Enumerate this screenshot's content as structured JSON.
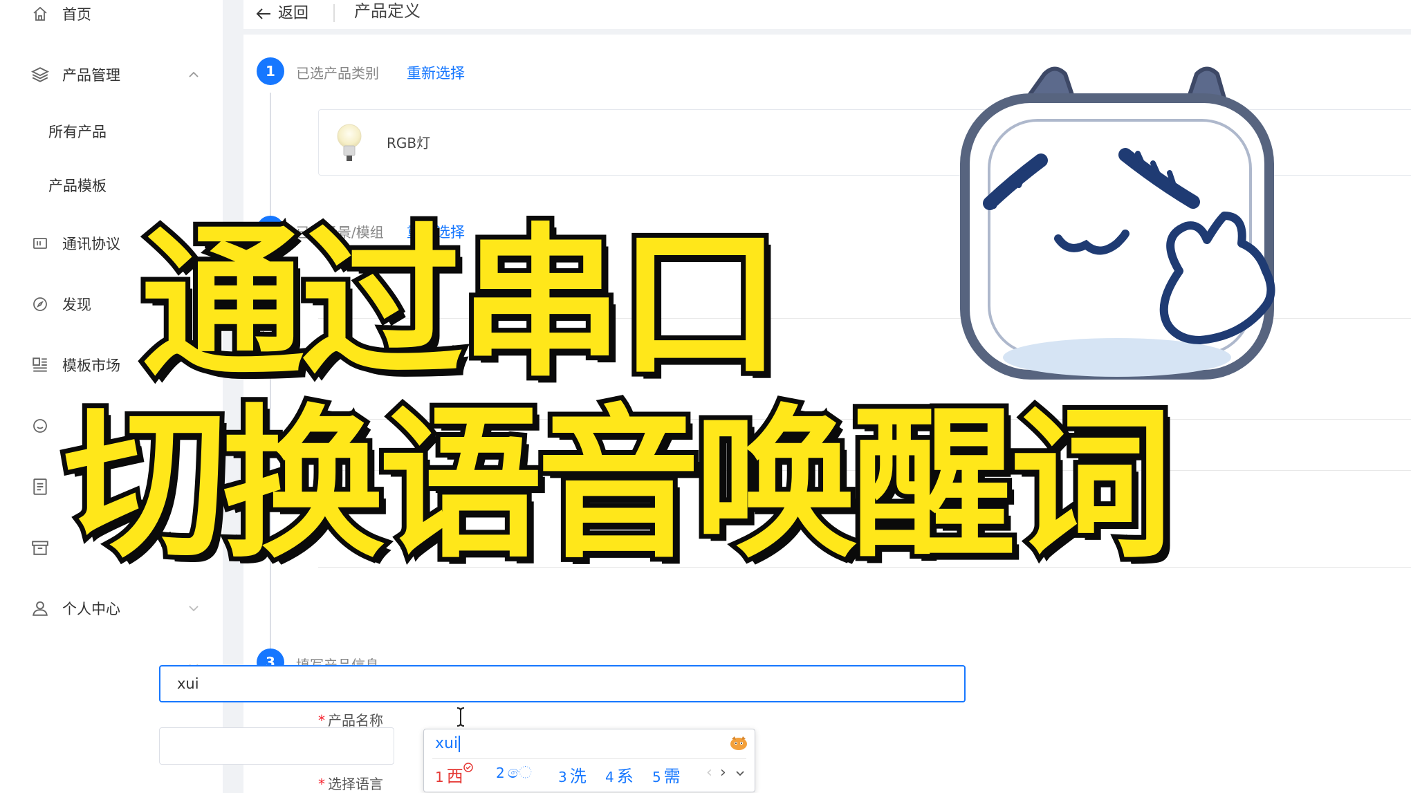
{
  "sidebar": {
    "items": [
      {
        "label": "首页",
        "icon": "home-icon"
      },
      {
        "label": "产品管理",
        "icon": "layers-icon",
        "expanded": true
      },
      {
        "label": "所有产品"
      },
      {
        "label": "产品模板"
      },
      {
        "label": "通讯协议",
        "icon": "protocol-icon"
      },
      {
        "label": "发现",
        "icon": "compass-icon"
      },
      {
        "label": "模板市场",
        "icon": "market-icon"
      },
      {
        "label": "个人中心",
        "icon": "user-icon"
      }
    ]
  },
  "header": {
    "back_label": "返回",
    "title": "产品定义"
  },
  "steps": [
    {
      "num": "1",
      "label": "已选产品类别",
      "action": "重新选择"
    },
    {
      "num": "2",
      "label": "已选场景/模组",
      "action": "重新选择"
    },
    {
      "num": "3",
      "label": "填写产品信息"
    }
  ],
  "product": {
    "name": "RGB灯",
    "icon": "bulb-icon"
  },
  "form": {
    "name_label": "产品名称",
    "name_value": "xui",
    "lang_label": "选择语言"
  },
  "ime": {
    "composition": "xui",
    "candidates": [
      {
        "num": "1",
        "text": "西"
      },
      {
        "num": "2",
        "text": "ෙ"
      },
      {
        "num": "3",
        "text": "洗"
      },
      {
        "num": "4",
        "text": "系"
      },
      {
        "num": "5",
        "text": "需"
      }
    ]
  },
  "overlay": {
    "line1": "通过串口",
    "line2": "切换语音唤醒词"
  },
  "colors": {
    "accent": "#1677ff",
    "overlay_fill": "#ffe71a",
    "overlay_stroke": "#0a0a0a"
  }
}
